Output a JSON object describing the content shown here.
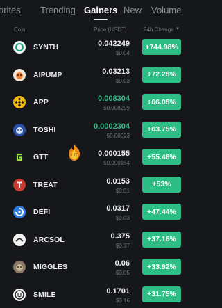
{
  "tabs": [
    {
      "label": "orites"
    },
    {
      "label": "Trending"
    },
    {
      "label": "Gainers"
    },
    {
      "label": "New"
    },
    {
      "label": "Volume"
    }
  ],
  "columns": {
    "coin": "Coin",
    "price": "Price (USDT)",
    "change": "24h Change"
  },
  "rows": [
    {
      "name": "SYNTH",
      "price": "0.042249",
      "sub": "$0.04",
      "change": "+744.98%",
      "icon": "synth-icon"
    },
    {
      "name": "AIPUMP",
      "price": "0.03213",
      "sub": "$0.03",
      "change": "+72.28%",
      "icon": "aipump-icon"
    },
    {
      "name": "APP",
      "price": "0.008304",
      "sub": "$0.008299",
      "change": "+66.08%",
      "icon": "app-icon"
    },
    {
      "name": "TOSHI",
      "price": "0.0002304",
      "sub": "$0.00023",
      "change": "+63.75%",
      "icon": "toshi-icon"
    },
    {
      "name": "GTT",
      "price": "0.000155",
      "sub": "$0.000154",
      "change": "+55.46%",
      "icon": "gtt-icon"
    },
    {
      "name": "TREAT",
      "price": "0.0153",
      "sub": "$0.01",
      "change": "+53%",
      "icon": "treat-icon"
    },
    {
      "name": "DEFI",
      "price": "0.0317",
      "sub": "$0.03",
      "change": "+47.44%",
      "icon": "defi-icon"
    },
    {
      "name": "ARCSOL",
      "price": "0.375",
      "sub": "$0.37",
      "change": "+37.16%",
      "icon": "arcsol-icon"
    },
    {
      "name": "MIGGLES",
      "price": "0.06",
      "sub": "$0.05",
      "change": "+33.92%",
      "icon": "miggles-icon"
    },
    {
      "name": "SMILE",
      "price": "0.1701",
      "sub": "$0.16",
      "change": "+31.75%",
      "icon": "smile-icon"
    }
  ],
  "lit_badge_text": "LIT",
  "colors": {
    "background": "#16171a",
    "positive": "#2ebd85",
    "muted": "#6f7379",
    "text": "#eaecef"
  }
}
